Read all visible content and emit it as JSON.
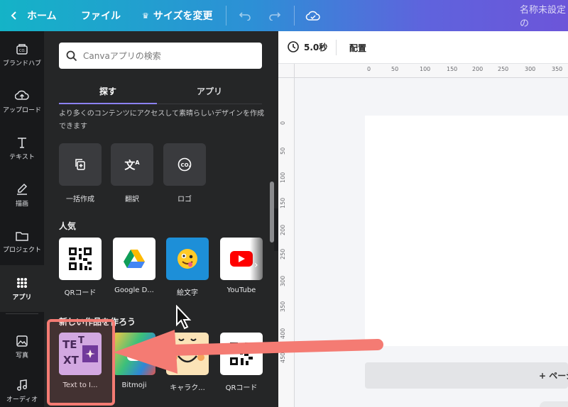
{
  "topbar": {
    "back_label": "ホーム",
    "file_label": "ファイル",
    "resize_label": "サイズを変更",
    "design_title": "名称未設定の"
  },
  "rail": {
    "items": [
      {
        "label": "ブランドハブ",
        "icon": "brand-hub-icon"
      },
      {
        "label": "アップロード",
        "icon": "upload-cloud-icon"
      },
      {
        "label": "テキスト",
        "icon": "text-icon"
      },
      {
        "label": "描画",
        "icon": "draw-pen-icon"
      },
      {
        "label": "プロジェクト",
        "icon": "folder-icon"
      },
      {
        "label": "アプリ",
        "icon": "apps-grid-icon",
        "active": true
      },
      {
        "label": "写真",
        "icon": "photo-icon"
      },
      {
        "label": "オーディオ",
        "icon": "music-note-icon"
      }
    ]
  },
  "panel": {
    "search": {
      "placeholder": "Canvaアプリの検索"
    },
    "tabs": [
      {
        "label": "探す",
        "active": true
      },
      {
        "label": "アプリ"
      }
    ],
    "intro_text": "より多くのコンテンツにアクセスして素晴らしいデザインを作成できます",
    "features": [
      {
        "label": "一括作成",
        "icon": "bulk-create-icon"
      },
      {
        "label": "翻訳",
        "icon": "translate-icon"
      },
      {
        "label": "ロゴ",
        "icon": "logo-co-icon"
      }
    ],
    "popular": {
      "title": "人気",
      "apps": [
        {
          "label": "QRコード",
          "icon": "qr-code-icon"
        },
        {
          "label": "Google D...",
          "icon": "google-drive-icon"
        },
        {
          "label": "絵文字",
          "icon": "emoji-icon"
        },
        {
          "label": "YouTube",
          "icon": "youtube-icon"
        }
      ]
    },
    "new_section": {
      "title": "新しい作品を作ろう",
      "apps": [
        {
          "label": "Text to I...",
          "icon": "text-to-image-icon"
        },
        {
          "label": "Bitmoji",
          "icon": "bitmoji-icon"
        },
        {
          "label": "キャラク...",
          "icon": "character-icon"
        },
        {
          "label": "QRコード",
          "icon": "qr-code-icon"
        }
      ]
    }
  },
  "editor": {
    "duration": "5.0秒",
    "arrange_label": "配置",
    "ruler_top": [
      "0",
      "50",
      "100",
      "150",
      "200",
      "250",
      "300",
      "350"
    ],
    "ruler_left": [
      "0",
      "50",
      "100",
      "150",
      "200",
      "250",
      "300",
      "350",
      "400",
      "450"
    ],
    "add_page_label": "+ ページ"
  },
  "colors": {
    "highlight": "#f47b73",
    "tab_underline": "#8c82f5",
    "panel_bg": "#252627",
    "rail_bg": "#18191b"
  }
}
